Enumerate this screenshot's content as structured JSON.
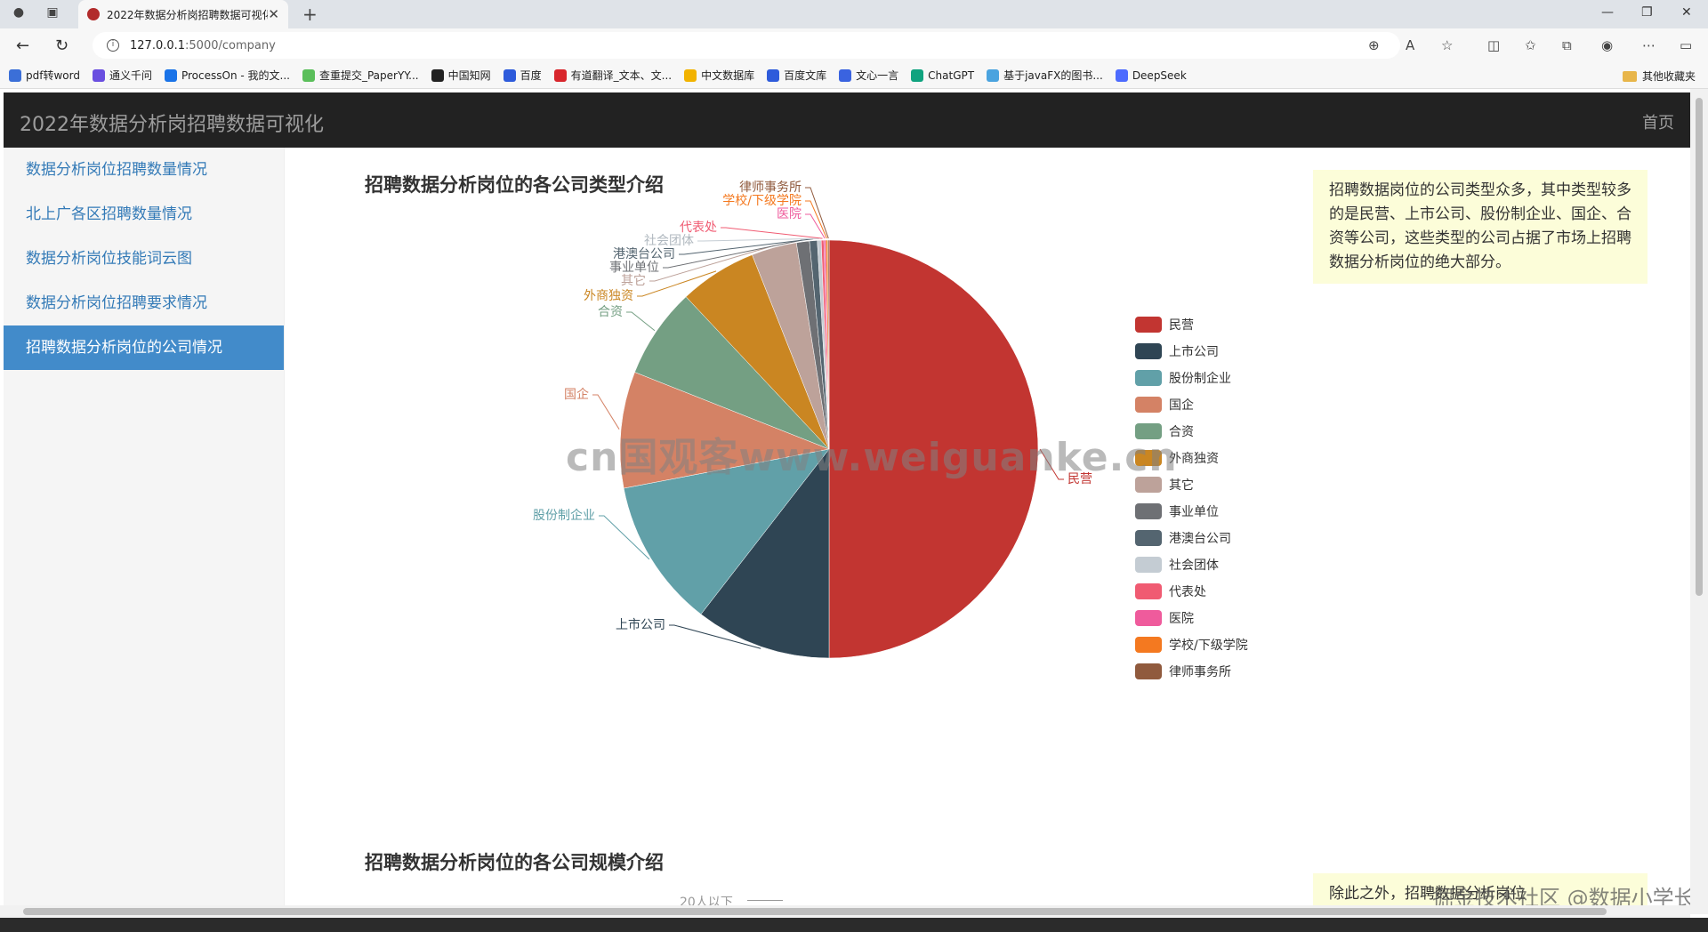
{
  "browser": {
    "tab_title": "2022年数据分析岗招聘数据可视化",
    "url_host": "127.0.0.1",
    "url_path": ":5000/company",
    "bookmarks": [
      {
        "label": "pdf转word",
        "color": "#3b6fd8"
      },
      {
        "label": "通义千问",
        "color": "#6a4fe0"
      },
      {
        "label": "ProcessOn - 我的文...",
        "color": "#1a73e8"
      },
      {
        "label": "查重提交_PaperYY...",
        "color": "#5bbf5b"
      },
      {
        "label": "中国知网",
        "color": "#222222"
      },
      {
        "label": "百度",
        "color": "#2e5bdb"
      },
      {
        "label": "有道翻译_文本、文...",
        "color": "#d8262c"
      },
      {
        "label": "中文数据库",
        "color": "#f2b300"
      },
      {
        "label": "百度文库",
        "color": "#2e5bdb"
      },
      {
        "label": "文心一言",
        "color": "#3a63e0"
      },
      {
        "label": "ChatGPT",
        "color": "#10a37f"
      },
      {
        "label": "基于javaFX的图书...",
        "color": "#4aa3df"
      },
      {
        "label": "DeepSeek",
        "color": "#4d6bfe"
      }
    ],
    "other_bookmarks": "其他收藏夹"
  },
  "header": {
    "brand": "2022年数据分析岗招聘数据可视化",
    "home": "首页"
  },
  "sidebar": {
    "items": [
      {
        "label": "数据分析岗位招聘数量情况",
        "active": false
      },
      {
        "label": "北上广各区招聘数量情况",
        "active": false
      },
      {
        "label": "数据分析岗位技能词云图",
        "active": false
      },
      {
        "label": "数据分析岗位招聘要求情况",
        "active": false
      },
      {
        "label": "招聘数据分析岗位的公司情况",
        "active": true
      }
    ]
  },
  "section1": {
    "title": "招聘数据分析岗位的各公司类型介绍",
    "note": "招聘数据岗位的公司类型众多，其中类型较多的是民营、上市公司、股份制企业、国企、合资等公司，这些类型的公司占据了市场上招聘数据分析岗位的绝大部分。"
  },
  "section2": {
    "title": "招聘数据分析岗位的各公司规模介绍",
    "note": "除此之外，招聘数据分析岗位",
    "first_label": "20人以下"
  },
  "watermarks": {
    "main": "cn国观客www.weiguanke.cn",
    "corner": "掘金技术社区 @数据小学长"
  },
  "chart_data": {
    "type": "pie",
    "title": "招聘数据分析岗位的各公司类型介绍",
    "legend_position": "right",
    "slices": [
      {
        "name": "民营",
        "value": 50.0,
        "color": "#c23531"
      },
      {
        "name": "上市公司",
        "value": 10.5,
        "color": "#2f4554"
      },
      {
        "name": "股份制企业",
        "value": 11.5,
        "color": "#61a0a8"
      },
      {
        "name": "国企",
        "value": 9.0,
        "color": "#d48265"
      },
      {
        "name": "合资",
        "value": 7.0,
        "color": "#749f83"
      },
      {
        "name": "外商独资",
        "value": 6.0,
        "color": "#ca8622"
      },
      {
        "name": "其它",
        "value": 3.5,
        "color": "#bda29a"
      },
      {
        "name": "事业单位",
        "value": 1.0,
        "color": "#6e7074"
      },
      {
        "name": "港澳台公司",
        "value": 0.6,
        "color": "#546570"
      },
      {
        "name": "社会团体",
        "value": 0.3,
        "color": "#c4ccd3"
      },
      {
        "name": "代表处",
        "value": 0.2,
        "color": "#f05b72"
      },
      {
        "name": "医院",
        "value": 0.15,
        "color": "#ef5b9c"
      },
      {
        "name": "学校/下级学院",
        "value": 0.15,
        "color": "#f47920"
      },
      {
        "name": "律师事务所",
        "value": 0.1,
        "color": "#905a3d"
      }
    ]
  }
}
